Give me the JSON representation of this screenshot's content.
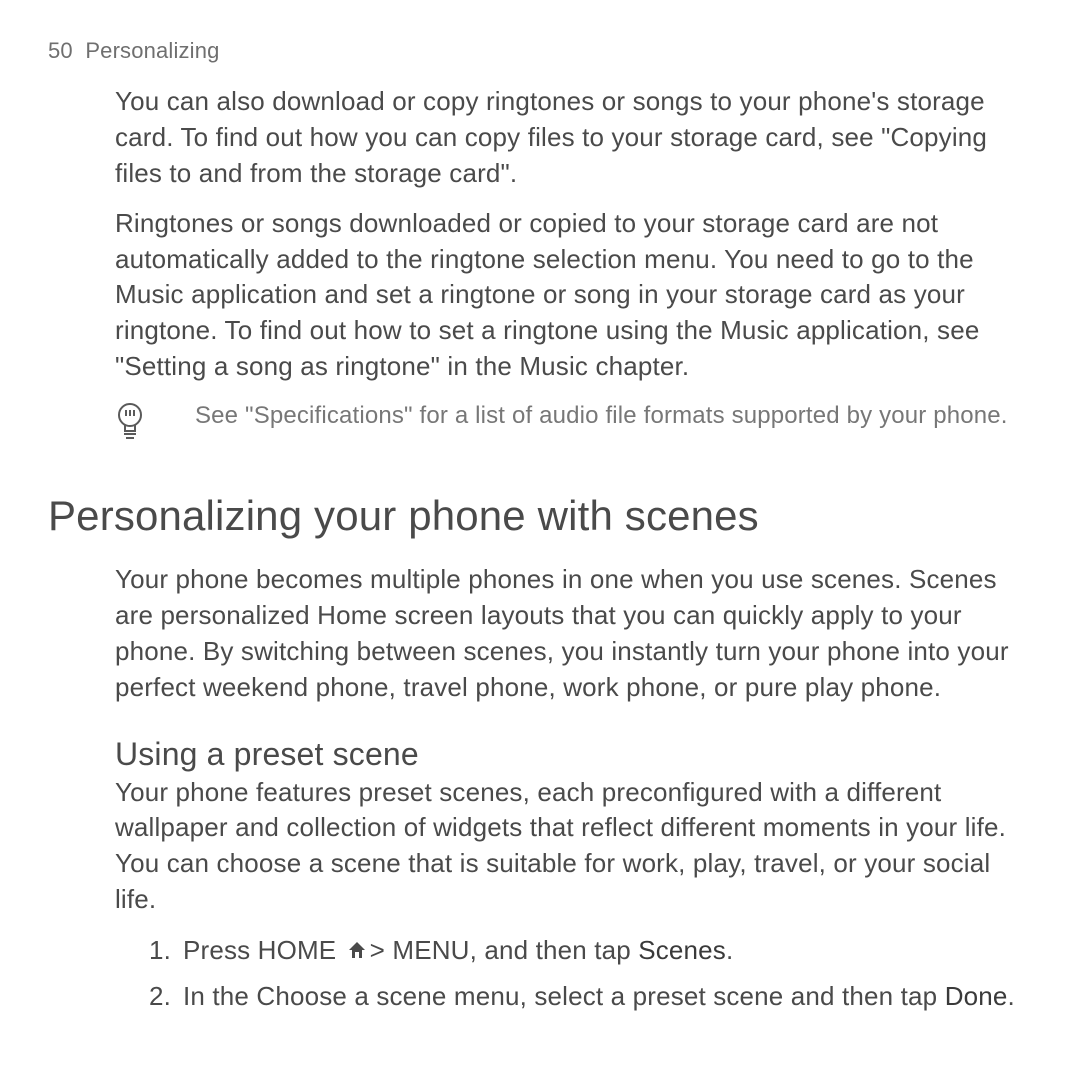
{
  "header": {
    "page_number": "50",
    "section": "Personalizing"
  },
  "para1": "You can also download or copy ringtones or songs to your phone's storage card. To find out how you can copy files to your storage card, see \"Copying files to and from the storage card\".",
  "para2": "Ringtones or songs downloaded or copied to your storage card are not automatically added to the ringtone selection menu. You need to go to the Music application and set a ringtone or song in your storage card as your ringtone. To find out how to set a ringtone using the Music application, see \"Setting a song as ringtone\" in the Music chapter.",
  "tip": "See \"Specifications\" for a list of audio file formats supported by your phone.",
  "heading1": "Personalizing your phone with scenes",
  "para3": "Your phone becomes multiple phones in one when you use scenes. Scenes are personalized Home screen layouts that you can quickly apply to your phone. By switching between scenes, you instantly turn your phone into your perfect weekend phone, travel phone, work phone, or pure play phone.",
  "heading2": "Using a preset scene",
  "para4": "Your phone features preset scenes, each preconfigured with a different wallpaper and collection of widgets that reflect different moments in your life. You can choose a scene that is suitable for work, play, travel, or your social life.",
  "steps": {
    "1": {
      "num": "1.",
      "a": "Press HOME ",
      "b": "> MENU, and then tap ",
      "c": "Scenes",
      "d": "."
    },
    "2": {
      "num": "2.",
      "a": "In the Choose a scene menu, select a preset scene and then tap ",
      "b": "Done",
      "c": "."
    }
  }
}
